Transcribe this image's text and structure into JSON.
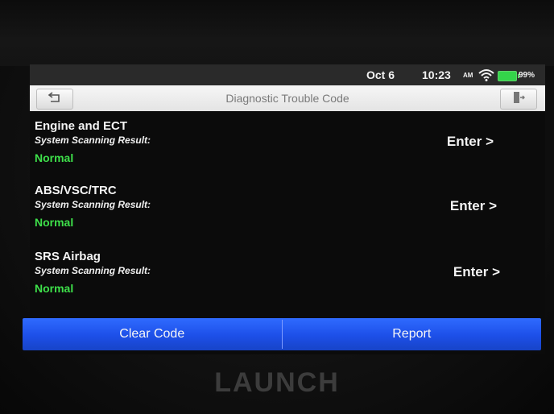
{
  "status_bar": {
    "date": "Oct 6",
    "time": "10:23",
    "ampm": "AM",
    "battery": "99%",
    "battery_level": 0.99,
    "wifi_icon": "wifi-icon",
    "battery_icon": "battery-icon"
  },
  "title_bar": {
    "title": "Diagnostic Trouble Code",
    "back_icon": "back-arrow-icon",
    "exit_icon": "exit-icon"
  },
  "modules": [
    {
      "name": "Engine and ECT",
      "result_label": "System Scanning Result:",
      "status": "Normal",
      "action": "Enter >"
    },
    {
      "name": "ABS/VSC/TRC",
      "result_label": "System Scanning Result:",
      "status": "Normal",
      "action": "Enter >"
    },
    {
      "name": "SRS Airbag",
      "result_label": "System Scanning Result:",
      "status": "Normal",
      "action": "Enter >"
    }
  ],
  "actions": {
    "clear_code": "Clear Code",
    "report": "Report"
  },
  "brand": "LAUNCH",
  "colors": {
    "accent_blue": "#1d4fe8",
    "normal_green": "#3ee04a",
    "battery_green": "#34d44a"
  }
}
